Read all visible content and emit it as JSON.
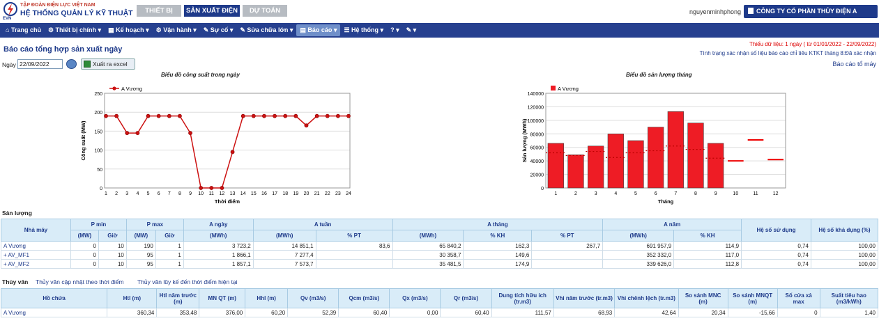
{
  "header": {
    "org_line": "TẬP ĐOÀN ĐIỆN LỰC VIỆT NAM",
    "system_title": "HỆ THỐNG QUẢN LÝ KỸ THUẬT",
    "logo_text": "EVN",
    "tabs": [
      "THIẾT BỊ",
      "SẢN XUẤT ĐIỆN",
      "DỰ TOÁN"
    ],
    "username": "nguyenminhphong",
    "company": "CÔNG TY CỔ PHẦN THỦY ĐIỆN A VƯƠNG"
  },
  "nav": [
    "Trang chủ",
    "Thiết bị chính",
    "Kế hoạch",
    "Vận hành",
    "Sự cố",
    "Sửa chữa lớn",
    "Báo cáo",
    "Hệ thống",
    "?",
    ""
  ],
  "page": {
    "title": "Báo cáo tổng hợp sản xuất ngày",
    "warning": "Thiếu dữ liệu: 1 ngày ( từ 01/01/2022 - 22/09/2022)",
    "status": "Tình trạng xác nhận số liệu báo cáo chỉ tiêu KTKT tháng 8:Đã xác nhận",
    "report_link": "Báo cáo tổ máy",
    "date_label": "Ngày",
    "date_value": "22/09/2022",
    "excel_button": "Xuất ra excel"
  },
  "chart_data": [
    {
      "type": "line",
      "title": "Biểu đồ công suất trong ngày",
      "xlabel": "Thời điểm",
      "ylabel": "Công suất (MW)",
      "ylim": [
        0,
        250
      ],
      "yticks": [
        "0",
        "50",
        "100",
        "150",
        "200",
        "250"
      ],
      "x": [
        1,
        2,
        3,
        4,
        5,
        6,
        7,
        8,
        9,
        10,
        11,
        12,
        13,
        14,
        15,
        16,
        17,
        18,
        19,
        20,
        21,
        22,
        23,
        24
      ],
      "series": [
        {
          "name": "A Vương",
          "color": "#cc1111",
          "values": [
            190,
            190,
            145,
            145,
            190,
            190,
            190,
            190,
            145,
            0,
            0,
            0,
            95,
            190,
            190,
            190,
            190,
            190,
            190,
            165,
            190,
            190,
            190,
            190
          ]
        }
      ],
      "legend": "top-left",
      "grid": true
    },
    {
      "type": "bar",
      "title": "Biểu đồ sản lượng tháng",
      "xlabel": "Tháng",
      "ylabel": "Sản lượng (MWh)",
      "ylim": [
        0,
        140000
      ],
      "yticks": [
        "0",
        "20000",
        "40000",
        "60000",
        "80000",
        "100000",
        "120000",
        "140000"
      ],
      "categories": [
        "1",
        "2",
        "3",
        "4",
        "5",
        "6",
        "7",
        "8",
        "9",
        "10",
        "11",
        "12"
      ],
      "series": [
        {
          "name": "A Vương",
          "color": "#ee1c25",
          "values": [
            66000,
            49000,
            62000,
            80000,
            70000,
            90000,
            113000,
            96000,
            66000,
            null,
            null,
            null
          ]
        }
      ],
      "plan": [
        null,
        null,
        null,
        null,
        null,
        null,
        null,
        null,
        null,
        40000,
        71000,
        42000
      ],
      "plan_dotted": [
        52000,
        48000,
        54000,
        45000,
        52000,
        55000,
        62000,
        57000,
        44000,
        null,
        null,
        null
      ],
      "legend": "top-left",
      "grid": true
    }
  ],
  "san_luong": {
    "section_label": "Sản lượng",
    "head_groups": [
      "Nhà máy",
      "P min",
      "P max",
      "A ngày",
      "A tuần",
      "A tháng",
      "A năm",
      "Hệ số sử dụng",
      "Hệ số khả dụng (%)"
    ],
    "sub_heads": [
      "(MW)",
      "Giờ",
      "(MW)",
      "Giờ",
      "(MWh)",
      "(MWh)",
      "% PT",
      "(MWh)",
      "% KH",
      "% PT",
      "(MWh)",
      "% KH"
    ],
    "rows": [
      [
        "A Vương",
        "0",
        "10",
        "190",
        "1",
        "3 723,2",
        "14 851,1",
        "83,6",
        "65 840,2",
        "162,3",
        "267,7",
        "691 957,9",
        "114,9",
        "0,74",
        "100,00"
      ],
      [
        "+ AV_MF1",
        "0",
        "10",
        "95",
        "1",
        "1 866,1",
        "7 277,4",
        "",
        "30 358,7",
        "149,6",
        "",
        "352 332,0",
        "117,0",
        "0,74",
        "100,00"
      ],
      [
        "+ AV_MF2",
        "0",
        "10",
        "95",
        "1",
        "1 857,1",
        "7 573,7",
        "",
        "35 481,5",
        "174,9",
        "",
        "339 626,0",
        "112,8",
        "0,74",
        "100,00"
      ]
    ]
  },
  "thuy_van": {
    "section_label": "Thủy văn",
    "link1": "Thủy văn cập nhật theo thời điểm",
    "link2": "Thủy văn lũy kế đến thời điểm hiện tại",
    "heads": [
      "Hồ chứa",
      "Htl (m)",
      "Htl năm trước (m)",
      "MN QT (m)",
      "Hhl (m)",
      "Qv (m3/s)",
      "Qcm (m3/s)",
      "Qx (m3/s)",
      "Qr (m3/s)",
      "Dung tích hữu ích (tr.m3)",
      "Vhi năm trước (tr.m3)",
      "Vhi chênh lệch (tr.m3)",
      "So sánh MNC (m)",
      "So sánh MNQT (m)",
      "Số cửa xả max",
      "Suất tiêu hao (m3/kWh)"
    ],
    "rows": [
      [
        "A Vương",
        "360,34",
        "353,48",
        "376,00",
        "60,20",
        "52,39",
        "60,40",
        "0,00",
        "60,40",
        "111,57",
        "68,93",
        "42,64",
        "20,34",
        "-15,66",
        "0",
        "1,40"
      ]
    ]
  }
}
